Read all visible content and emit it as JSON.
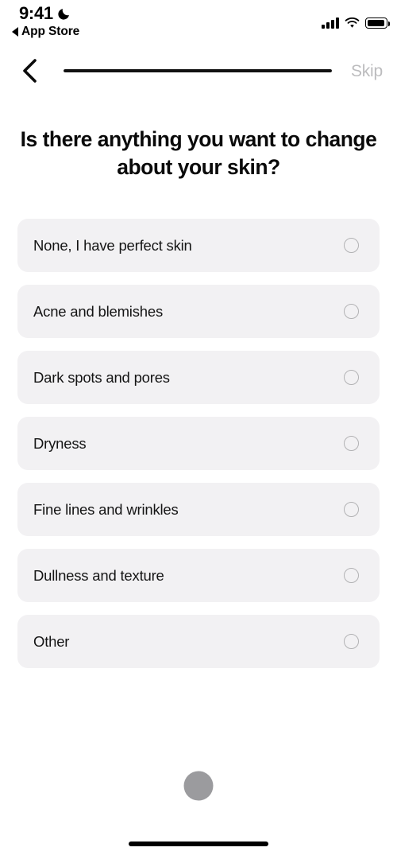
{
  "status_bar": {
    "time": "9:41",
    "dnd_icon": "moon-icon",
    "return_app_label": "App Store",
    "return_app_icon": "back-triangle-icon",
    "signal_icon": "cellular-signal-icon",
    "wifi_icon": "wifi-icon",
    "battery_icon": "battery-full-icon"
  },
  "nav_bar": {
    "back_icon": "chevron-left-icon",
    "skip_label": "Skip",
    "progress_percent": 100
  },
  "question": {
    "title": "Is there anything you want to change about your skin?"
  },
  "options": [
    {
      "label": "None, I have perfect skin",
      "selected": false
    },
    {
      "label": "Acne and blemishes",
      "selected": false
    },
    {
      "label": "Dark spots and pores",
      "selected": false
    },
    {
      "label": "Dryness",
      "selected": false
    },
    {
      "label": "Fine lines and wrinkles",
      "selected": false
    },
    {
      "label": "Dullness and texture",
      "selected": false
    },
    {
      "label": "Other",
      "selected": false
    }
  ],
  "continue_button": {
    "label": "",
    "enabled": false
  },
  "colors": {
    "background": "#ffffff",
    "option_background": "#f2f1f3",
    "text_primary": "#151515",
    "skip_text": "#bcbcbe",
    "radio_border": "#b2b2b4",
    "progress_fill": "#111111",
    "progress_track": "#e3e3e3",
    "continue_button": "#9b9b9e",
    "home_indicator": "#000000"
  }
}
